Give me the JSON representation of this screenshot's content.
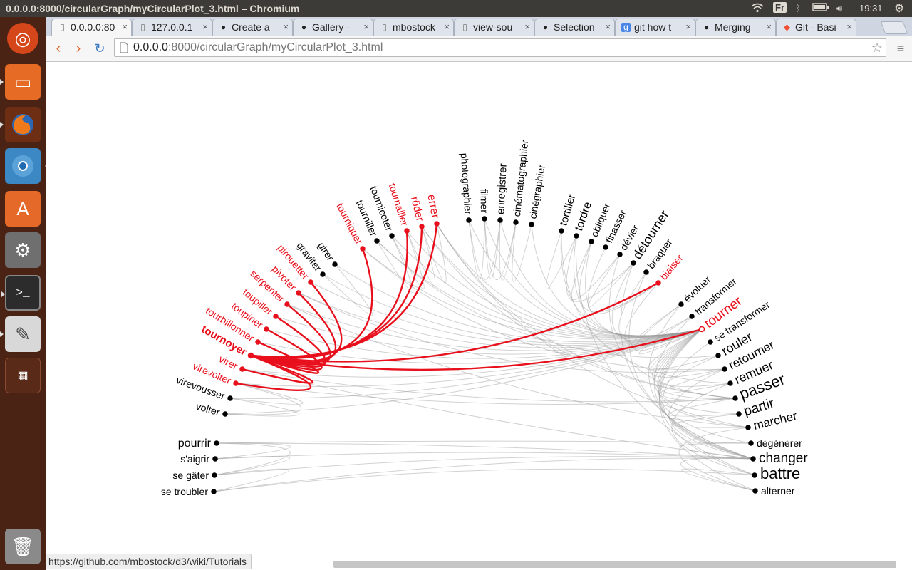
{
  "window": {
    "title": "0.0.0.0:8000/circularGraph/myCircularPlot_3.html – Chromium"
  },
  "system": {
    "keyboard": "Fr",
    "time": "19:31"
  },
  "tabs": [
    {
      "label": "0.0.0.0:80",
      "icon": "page-icon",
      "active": true
    },
    {
      "label": "127.0.0.1",
      "icon": "page-icon",
      "active": false
    },
    {
      "label": "Create a",
      "icon": "github-icon",
      "active": false
    },
    {
      "label": "Gallery ·",
      "icon": "github-icon",
      "active": false
    },
    {
      "label": "mbostock",
      "icon": "page-icon",
      "active": false
    },
    {
      "label": "view-sou",
      "icon": "page-icon",
      "active": false
    },
    {
      "label": "Selection",
      "icon": "github-icon",
      "active": false
    },
    {
      "label": "git how t",
      "icon": "google-icon",
      "active": false
    },
    {
      "label": "Merging",
      "icon": "github-icon",
      "active": false
    },
    {
      "label": "Git - Basi",
      "icon": "git-icon",
      "active": false
    }
  ],
  "address": {
    "host": "0.0.0.0",
    "path": ":8000/circularGraph/myCircularPlot_3.html"
  },
  "status_url": "https://github.com/mbostock/d3/wiki/Tutorials",
  "colors": {
    "highlight": "#e8101c",
    "default": "#000000",
    "link": "#9a9a9a"
  },
  "graph": {
    "focus": "tournoyer",
    "nodes": [
      {
        "id": "pourrir",
        "hl": false
      },
      {
        "id": "s'aigrir",
        "hl": false
      },
      {
        "id": "se gâter",
        "hl": false
      },
      {
        "id": "se troubler",
        "hl": false
      },
      {
        "id": "volter",
        "hl": false
      },
      {
        "id": "virevousser",
        "hl": false
      },
      {
        "id": "virevolter",
        "hl": true
      },
      {
        "id": "virer",
        "hl": true
      },
      {
        "id": "tournoyer",
        "hl": true
      },
      {
        "id": "tourbillonner",
        "hl": true
      },
      {
        "id": "toupiner",
        "hl": true
      },
      {
        "id": "toupiller",
        "hl": true
      },
      {
        "id": "serpenter",
        "hl": true
      },
      {
        "id": "pivoter",
        "hl": true
      },
      {
        "id": "pirouetter",
        "hl": true
      },
      {
        "id": "graviter",
        "hl": false
      },
      {
        "id": "girer",
        "hl": false
      },
      {
        "id": "tourniquer",
        "hl": true
      },
      {
        "id": "tourniller",
        "hl": false
      },
      {
        "id": "tournicoter",
        "hl": false
      },
      {
        "id": "tournailler",
        "hl": true
      },
      {
        "id": "rôder",
        "hl": true
      },
      {
        "id": "errer",
        "hl": true
      },
      {
        "id": "photographier",
        "hl": false
      },
      {
        "id": "filmer",
        "hl": false
      },
      {
        "id": "enregistrer",
        "hl": false
      },
      {
        "id": "cinématographier",
        "hl": false
      },
      {
        "id": "cinégraphier",
        "hl": false
      },
      {
        "id": "tortiller",
        "hl": false
      },
      {
        "id": "tordre",
        "hl": false
      },
      {
        "id": "obliquer",
        "hl": false
      },
      {
        "id": "finasser",
        "hl": false
      },
      {
        "id": "dévier",
        "hl": false
      },
      {
        "id": "détourner",
        "hl": false
      },
      {
        "id": "braquer",
        "hl": false
      },
      {
        "id": "biaiser",
        "hl": true
      },
      {
        "id": "évoluer",
        "hl": false
      },
      {
        "id": "transformer",
        "hl": false
      },
      {
        "id": "tourner",
        "hl": true
      },
      {
        "id": "se transformer",
        "hl": false
      },
      {
        "id": "rouler",
        "hl": false
      },
      {
        "id": "retourner",
        "hl": false
      },
      {
        "id": "remuer",
        "hl": false
      },
      {
        "id": "passer",
        "hl": false
      },
      {
        "id": "partir",
        "hl": false
      },
      {
        "id": "marcher",
        "hl": false
      },
      {
        "id": "dégénérer",
        "hl": false
      },
      {
        "id": "changer",
        "hl": false
      },
      {
        "id": "battre",
        "hl": false
      },
      {
        "id": "alterner",
        "hl": false
      }
    ],
    "links": [
      [
        "tournoyer",
        "virevolter"
      ],
      [
        "tournoyer",
        "virer"
      ],
      [
        "tournoyer",
        "tourbillonner"
      ],
      [
        "tournoyer",
        "toupiner"
      ],
      [
        "tournoyer",
        "toupiller"
      ],
      [
        "tournoyer",
        "serpenter"
      ],
      [
        "tournoyer",
        "pivoter"
      ],
      [
        "tournoyer",
        "pirouetter"
      ],
      [
        "tournoyer",
        "tourniquer"
      ],
      [
        "tournoyer",
        "tournailler"
      ],
      [
        "tournoyer",
        "rôder"
      ],
      [
        "tournoyer",
        "errer"
      ],
      [
        "tournoyer",
        "biaiser"
      ],
      [
        "tournoyer",
        "tourner"
      ],
      [
        "pourrir",
        "s'aigrir"
      ],
      [
        "pourrir",
        "se gâter"
      ],
      [
        "pourrir",
        "changer"
      ],
      [
        "s'aigrir",
        "se gâter"
      ],
      [
        "se gâter",
        "se troubler"
      ],
      [
        "s'aigrir",
        "changer"
      ],
      [
        "se gâter",
        "changer"
      ],
      [
        "se troubler",
        "changer"
      ],
      [
        "pourrir",
        "dégénérer"
      ],
      [
        "se troubler",
        "battre"
      ],
      [
        "volter",
        "virevousser"
      ],
      [
        "volter",
        "virevolter"
      ],
      [
        "virevousser",
        "virevolter"
      ],
      [
        "volter",
        "tourner"
      ],
      [
        "virevousser",
        "tourner"
      ],
      [
        "virevolter",
        "tourner"
      ],
      [
        "virer",
        "tourner"
      ],
      [
        "virer",
        "changer"
      ],
      [
        "virevolter",
        "passer"
      ],
      [
        "tourbillonner",
        "tourner"
      ],
      [
        "toupiner",
        "tourner"
      ],
      [
        "toupiller",
        "tourner"
      ],
      [
        "serpenter",
        "tourner"
      ],
      [
        "pivoter",
        "tourner"
      ],
      [
        "pirouetter",
        "tourner"
      ],
      [
        "graviter",
        "tourner"
      ],
      [
        "girer",
        "tourner"
      ],
      [
        "tourniquer",
        "tourner"
      ],
      [
        "tourniller",
        "tourner"
      ],
      [
        "tournicoter",
        "tourner"
      ],
      [
        "tournailler",
        "tourner"
      ],
      [
        "rôder",
        "tourner"
      ],
      [
        "errer",
        "tourner"
      ],
      [
        "graviter",
        "girer"
      ],
      [
        "tourniller",
        "tournicoter"
      ],
      [
        "tournicoter",
        "tournailler"
      ],
      [
        "tournailler",
        "rôder"
      ],
      [
        "rôder",
        "errer"
      ],
      [
        "errer",
        "passer"
      ],
      [
        "errer",
        "marcher"
      ],
      [
        "rôder",
        "passer"
      ],
      [
        "tourniller",
        "rouler"
      ],
      [
        "photographier",
        "filmer"
      ],
      [
        "filmer",
        "enregistrer"
      ],
      [
        "enregistrer",
        "cinématographier"
      ],
      [
        "cinématographier",
        "cinégraphier"
      ],
      [
        "photographier",
        "enregistrer"
      ],
      [
        "filmer",
        "cinématographier"
      ],
      [
        "photographier",
        "tourner"
      ],
      [
        "filmer",
        "tourner"
      ],
      [
        "enregistrer",
        "tourner"
      ],
      [
        "cinégraphier",
        "tourner"
      ],
      [
        "tortiller",
        "tordre"
      ],
      [
        "tortiller",
        "tourner"
      ],
      [
        "tordre",
        "tourner"
      ],
      [
        "tordre",
        "détourner"
      ],
      [
        "obliquer",
        "tourner"
      ],
      [
        "obliquer",
        "dévier"
      ],
      [
        "finasser",
        "biaiser"
      ],
      [
        "dévier",
        "détourner"
      ],
      [
        "détourner",
        "tourner"
      ],
      [
        "détourner",
        "changer"
      ],
      [
        "braquer",
        "tourner"
      ],
      [
        "biaiser",
        "tourner"
      ],
      [
        "biaiser",
        "obliquer"
      ],
      [
        "évoluer",
        "tourner"
      ],
      [
        "évoluer",
        "changer"
      ],
      [
        "évoluer",
        "transformer"
      ],
      [
        "transformer",
        "changer"
      ],
      [
        "transformer",
        "tourner"
      ],
      [
        "se transformer",
        "changer"
      ],
      [
        "tourner",
        "rouler"
      ],
      [
        "tourner",
        "retourner"
      ],
      [
        "tourner",
        "remuer"
      ],
      [
        "tourner",
        "passer"
      ],
      [
        "tourner",
        "partir"
      ],
      [
        "tourner",
        "marcher"
      ],
      [
        "tourner",
        "dégénérer"
      ],
      [
        "tourner",
        "changer"
      ],
      [
        "tourner",
        "battre"
      ],
      [
        "tourner",
        "alterner"
      ],
      [
        "rouler",
        "passer"
      ],
      [
        "retourner",
        "changer"
      ],
      [
        "remuer",
        "battre"
      ],
      [
        "passer",
        "partir"
      ],
      [
        "partir",
        "marcher"
      ],
      [
        "marcher",
        "alterner"
      ],
      [
        "changer",
        "alterner"
      ],
      [
        "battre",
        "alterner"
      ],
      [
        "dégénérer",
        "changer"
      ],
      [
        "retourner",
        "remuer"
      ],
      [
        "tortiller",
        "remuer"
      ],
      [
        "tordre",
        "battre"
      ],
      [
        "dévier",
        "passer"
      ],
      [
        "braquer",
        "changer"
      ],
      [
        "tourniquer",
        "retourner"
      ],
      [
        "pivoter",
        "retourner"
      ],
      [
        "virer",
        "passer"
      ],
      [
        "serpenter",
        "marcher"
      ]
    ]
  }
}
